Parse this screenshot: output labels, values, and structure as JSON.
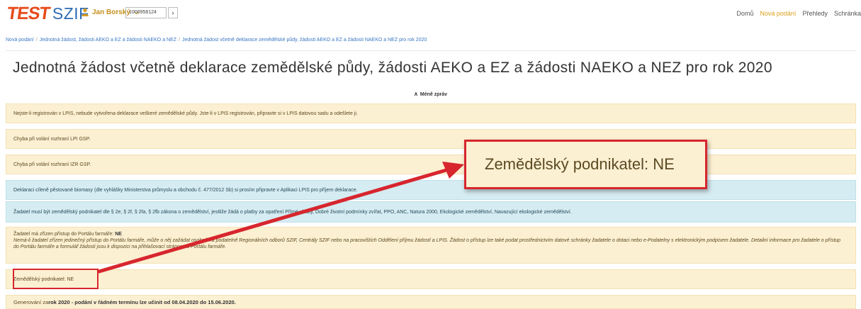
{
  "header": {
    "logo_test": "TEST",
    "logo_szif": "SZIF",
    "user_name": "Jan Borský",
    "client_id": "1000958124",
    "go_label": "›",
    "nav": [
      {
        "label": "Domů"
      },
      {
        "label": "Nová podání"
      },
      {
        "label": "Přehledy"
      },
      {
        "label": "Schránka"
      }
    ]
  },
  "breadcrumb": [
    "Nová podání",
    "Jednotná žádost, žádosti AEKO a EZ a žádosti NAEKO a NEZ",
    "Jednotná žádost včetně deklarace zemědělské půdy, žádosti AEKO a EZ a žádosti NAEKO a NEZ pro rok 2020"
  ],
  "page_title": "Jednotná žádost včetně deklarace zemědělské půdy, žádosti AEKO a EZ a žádosti NAEKO a NEZ pro rok 2020",
  "less_messages": "Méně zpráv",
  "messages": {
    "m1": "Nejste-li registrován v LPIS, nebude vytvořena deklarace veškeré zemědělské půdy. Jste-li v LPIS registrován, připravte si v LPIS datovou sadu a odešlete ji.",
    "m2": "Chyba při volání rozhraní LPI GSP.",
    "m3": "Chyba při volání rozhraní IZR GSP.",
    "m4": "Deklaraci cíleně pěstované biomasy (dle vyhlášky Ministerstva průmyslu a obchodu č. 477/2012 Sb) si prosím připravte v Aplikaci LPIS pro příjem deklarace.",
    "m5": "Žadatel musí být zemědělský podnikatel dle § 2e, § 2f, § 2fa, § 2fb zákona o zemědělství, jestliže žádá o platby za opatření Přímé platby, Dobré životní podmínky zvířat, PPO, ANC, Natura 2000, Ekologické zemědělství, Navazující ekologické zemědělství.",
    "m6_prefix": "Žadatel má zřízen přístup do Portálu farmáře: ",
    "m6_value": "NE",
    "m6_detail": "Nemá-li žadatel zřízen jedinečný přístup do Portálu farmáře, může o něj zažádat osobně na podatelně Regionálních odborů SZIF, Centrály SZIF nebo na pracovištích Oddělení příjmu žádostí a LPIS. Žádost o přístup lze také podat prostřednictvím datové schránky žadatele o dotaci nebo e-Podatelny s elektronickým podpisem žadatele. Detailní informace pro žadatele o přístup do Portálu farmáře a formulář žádosti jsou k dispozici na přihlašovací stránce do Portálu farmáře.",
    "m7": "Zemědělský podnikatel: NE",
    "m8_prefix": "Generování za ",
    "m8_bold": "rok 2020 - podání v řádném termínu lze učinit od 08.04.2020 do 15.06.2020."
  },
  "highlight_text": "Zemědělský podnikatel: NE",
  "colors": {
    "warning_bg": "#fcf0d2",
    "info_bg": "#d5ecf2",
    "highlight_border": "#d7262e",
    "link": "#3a77c4",
    "active_nav": "#d9a11e"
  }
}
